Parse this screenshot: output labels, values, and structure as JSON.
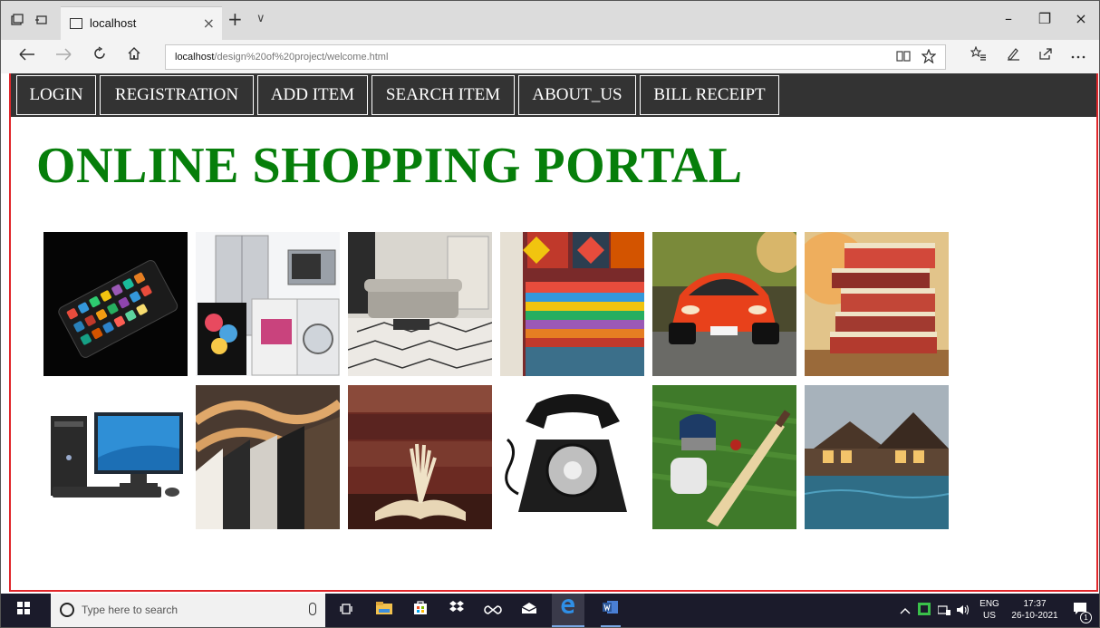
{
  "browser": {
    "tab_title": "localhost",
    "tab_close": "×",
    "new_tab": "+",
    "tab_menu": "∨",
    "url_host": "localhost",
    "url_path": "/design%20of%20project/welcome.html",
    "minimize": "–",
    "restore": "❐",
    "close": "×"
  },
  "nav": {
    "items": [
      "LOGIN",
      "REGISTRATION",
      "ADD ITEM",
      "SEARCH ITEM",
      "ABOUT_US",
      "BILL RECEIPT"
    ]
  },
  "page": {
    "title": "ONLINE SHOPPING PORTAL"
  },
  "gallery": [
    "smartphone-image",
    "appliances-image",
    "living-room-image",
    "textiles-image",
    "sports-car-image",
    "books-stack-image",
    "desktop-computer-image",
    "clothes-rack-image",
    "open-book-image",
    "rotary-telephone-image",
    "cricket-gear-image",
    "villa-pool-image"
  ],
  "taskbar": {
    "search_placeholder": "Type here to search",
    "lang_top": "ENG",
    "lang_bottom": "US",
    "time": "17:37",
    "date": "26-10-2021",
    "notification_count": "1"
  },
  "colors": {
    "title": "#067e0a",
    "nav_bg": "#333333",
    "viewport_border": "#e0262a",
    "taskbar_bg": "#1b1b2b"
  }
}
